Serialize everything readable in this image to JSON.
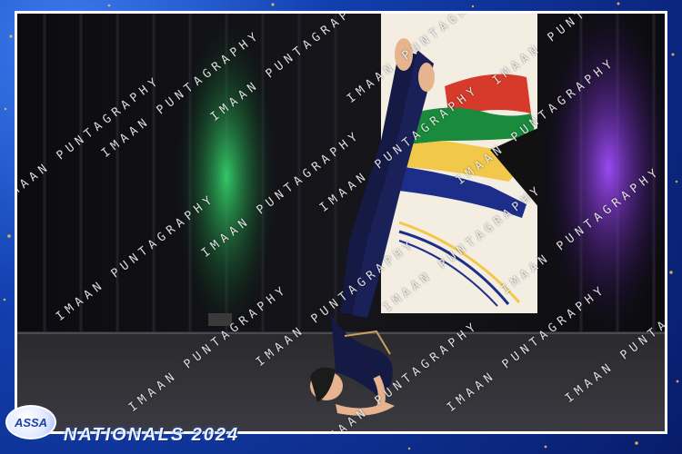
{
  "event": {
    "logo_text": "ASSA",
    "banner_text": "NATIONALS 2024"
  },
  "watermark": {
    "text": "IMAAN PUNTAGRAPHY"
  },
  "scene": {
    "subject": "performer-in-chest-stand",
    "backdrop": "stage-curtain",
    "flag_banner": "south-african-flag-banner"
  },
  "colors": {
    "frame_blue": "#1240b0",
    "stage_light_green": "#1fae4a",
    "stage_light_purple": "#8a2be2",
    "costume": "#141a44"
  }
}
